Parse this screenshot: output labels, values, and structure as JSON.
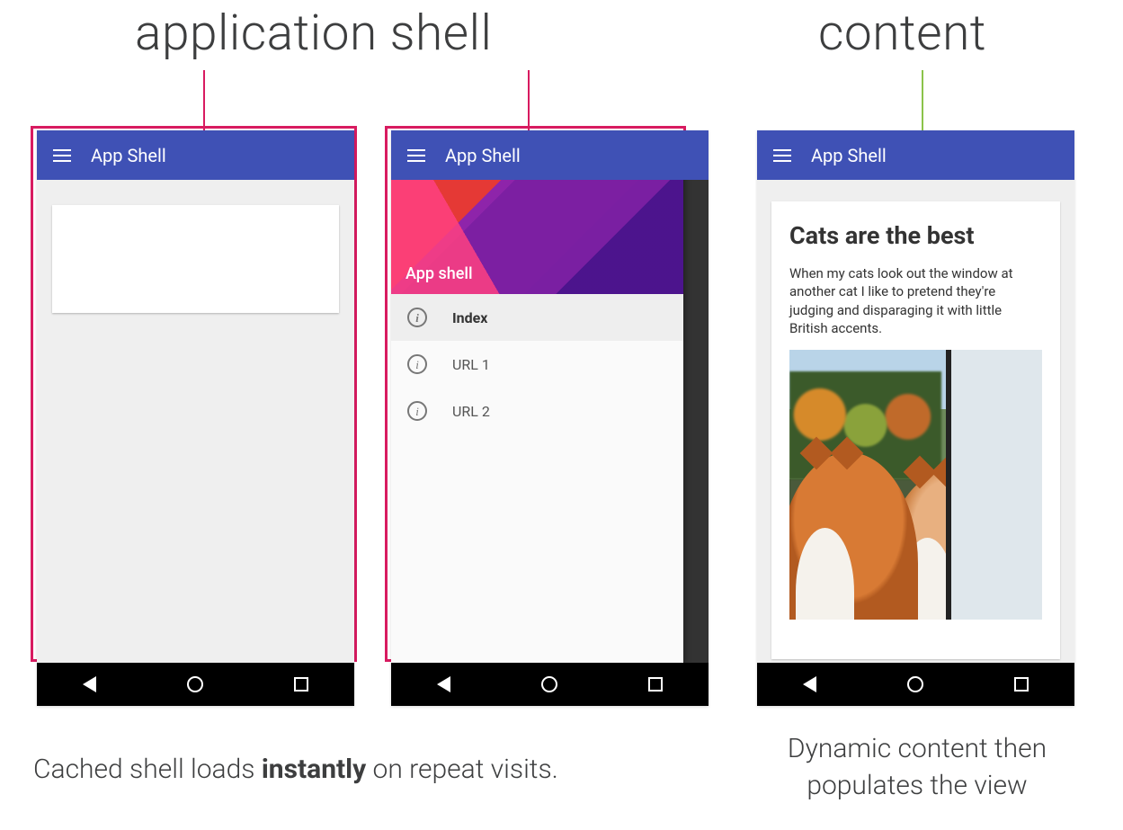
{
  "labels": {
    "shell": "application shell",
    "content": "content"
  },
  "captions": {
    "shell_pre": "Cached shell loads ",
    "shell_bold": "instantly",
    "shell_post": " on repeat visits.",
    "content": "Dynamic content then populates the view"
  },
  "appbar_title": "App Shell",
  "drawer": {
    "title": "App shell",
    "items": [
      {
        "label": "Index",
        "active": true
      },
      {
        "label": "URL 1",
        "active": false
      },
      {
        "label": "URL 2",
        "active": false
      }
    ]
  },
  "content_card": {
    "heading": "Cats are the best",
    "body": "When my cats look out the window at another cat I like to pretend they're judging and disparaging it with little British accents."
  }
}
